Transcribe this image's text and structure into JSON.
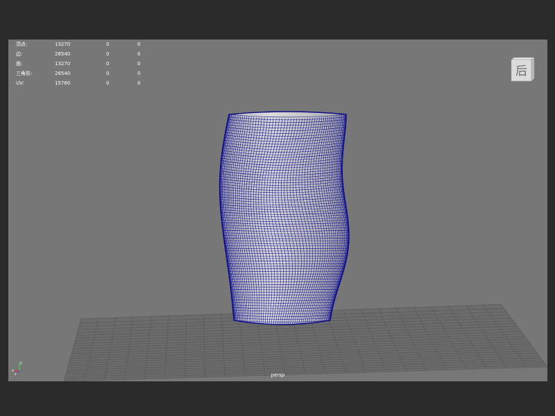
{
  "stats": [
    {
      "label": "顶点:",
      "values": [
        "13270",
        "0",
        "0"
      ]
    },
    {
      "label": "边:",
      "values": [
        "26540",
        "0",
        "0"
      ]
    },
    {
      "label": "面:",
      "values": [
        "13270",
        "0",
        "0"
      ]
    },
    {
      "label": "三角形:",
      "values": [
        "26540",
        "0",
        "0"
      ]
    },
    {
      "label": "UV:",
      "values": [
        "15760",
        "0",
        "0"
      ]
    }
  ],
  "viewcube": {
    "face_label": "后"
  },
  "camera": {
    "label": "persp"
  },
  "axis": {
    "x": "x",
    "y": "y",
    "z": "z"
  },
  "colors": {
    "viewport_bg": "#777777",
    "outer_bg": "#2b2b2b",
    "wireframe": "#0b0b8c",
    "mesh_fill": "#cfcfcf",
    "grid": "#5a5a5a"
  }
}
